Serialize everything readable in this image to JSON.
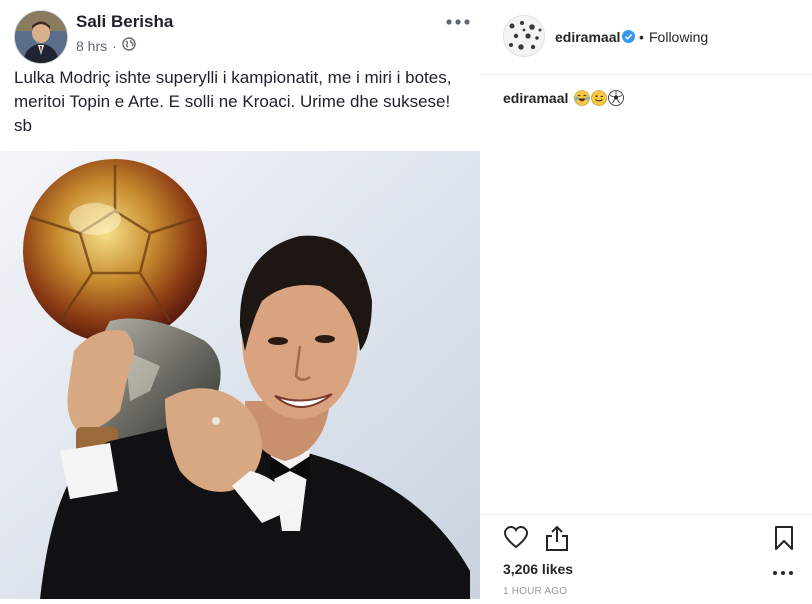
{
  "facebook_post": {
    "author": "Sali Berisha",
    "time": "8 hrs",
    "separator": "·",
    "audience_icon": "globe-icon",
    "more_icon": "more-horizontal-icon",
    "text": "Lulka Modriç ishte superylli i kampionatit, me i miri i botes, meritoi Topin e Arte. E solli ne Kroaci. Urime dhe suksese! sb",
    "photo_icon": "photo-golden-ball-trophy"
  },
  "instagram": {
    "username": "ediramaal",
    "verified_icon": "verified-badge-icon",
    "separator": "•",
    "follow_status": "Following",
    "caption_user": "ediramaal",
    "caption_emojis": [
      "laughing-tears-emoji",
      "winking-emoji",
      "soccer-ball-emoji"
    ],
    "likes": "3,206 likes",
    "time": "1 HOUR AGO",
    "icons": [
      "heart-icon",
      "share-icon",
      "bookmark-icon",
      "more-horizontal-icon"
    ]
  },
  "colors": {
    "fb_text": "#1d2129",
    "fb_meta": "#616770",
    "ig_text": "#262626",
    "ig_verified": "#3897f0",
    "ig_muted": "#999999"
  }
}
